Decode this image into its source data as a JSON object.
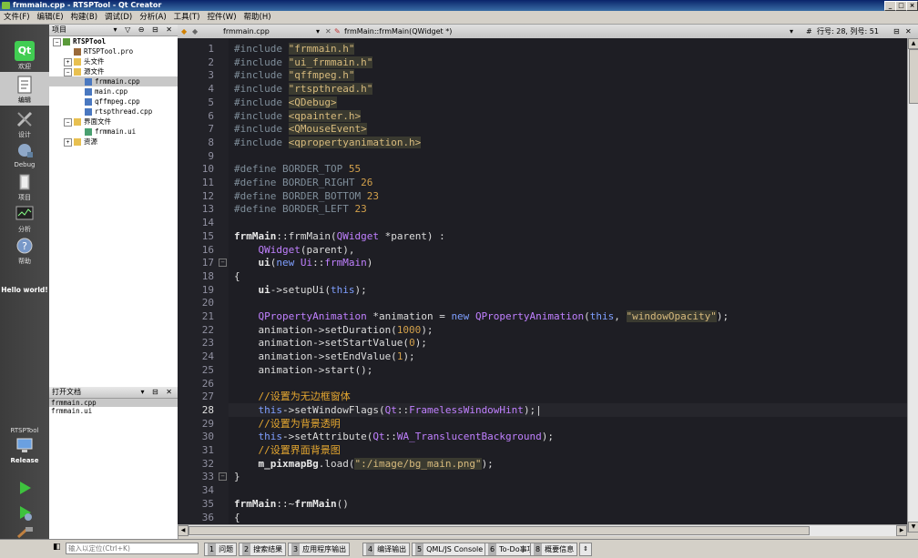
{
  "window": {
    "title": "frmmain.cpp - RTSPTool - Qt Creator",
    "controls": [
      "_",
      "□",
      "×"
    ]
  },
  "menu": [
    "文件(F)",
    "编辑(E)",
    "构建(B)",
    "调试(D)",
    "分析(A)",
    "工具(T)",
    "控件(W)",
    "帮助(H)"
  ],
  "modes": [
    {
      "label": "欢迎",
      "icon": "qt-logo-icon"
    },
    {
      "label": "编辑",
      "icon": "edit-icon"
    },
    {
      "label": "设计",
      "icon": "design-icon"
    },
    {
      "label": "Debug",
      "icon": "debug-icon"
    },
    {
      "label": "项目",
      "icon": "project-icon"
    },
    {
      "label": "分析",
      "icon": "analyze-icon"
    },
    {
      "label": "帮助",
      "icon": "help-icon"
    }
  ],
  "sidebar_note": "Hello world!",
  "kit": {
    "project": "RTSPTool",
    "config": "Release"
  },
  "project_panel": {
    "title": "项目",
    "tree": [
      {
        "label": "RTSPTool",
        "depth": 0,
        "expander": "−",
        "icon": "project"
      },
      {
        "label": "RTSPTool.pro",
        "depth": 1,
        "expander": "",
        "icon": "pro"
      },
      {
        "label": "头文件",
        "depth": 1,
        "expander": "+",
        "icon": "folder"
      },
      {
        "label": "源文件",
        "depth": 1,
        "expander": "−",
        "icon": "folder"
      },
      {
        "label": "frmmain.cpp",
        "depth": 2,
        "expander": "",
        "icon": "cpp",
        "selected": true
      },
      {
        "label": "main.cpp",
        "depth": 2,
        "expander": "",
        "icon": "cpp"
      },
      {
        "label": "qffmpeg.cpp",
        "depth": 2,
        "expander": "",
        "icon": "cpp"
      },
      {
        "label": "rtspthread.cpp",
        "depth": 2,
        "expander": "",
        "icon": "cpp"
      },
      {
        "label": "界面文件",
        "depth": 1,
        "expander": "−",
        "icon": "folder"
      },
      {
        "label": "frmmain.ui",
        "depth": 2,
        "expander": "",
        "icon": "ui"
      },
      {
        "label": "资源",
        "depth": 1,
        "expander": "+",
        "icon": "folder"
      }
    ]
  },
  "open_docs": {
    "title": "打开文档",
    "items": [
      "frmmain.cpp",
      "frmmain.ui"
    ]
  },
  "editor_toolbar": {
    "file": "frmmain.cpp",
    "symbol": "frmMain::frmMain(QWidget *)",
    "position": "行号: 28, 列号: 51"
  },
  "code": {
    "current_line": 28,
    "lines": [
      [
        [
          "pp",
          "#include "
        ],
        [
          "inc",
          "\"frmmain.h\""
        ]
      ],
      [
        [
          "pp",
          "#include "
        ],
        [
          "inc",
          "\"ui_frmmain.h\""
        ]
      ],
      [
        [
          "pp",
          "#include "
        ],
        [
          "inc",
          "\"qffmpeg.h\""
        ]
      ],
      [
        [
          "pp",
          "#include "
        ],
        [
          "inc",
          "\"rtspthread.h\""
        ]
      ],
      [
        [
          "pp",
          "#include "
        ],
        [
          "inc",
          "<QDebug>"
        ]
      ],
      [
        [
          "pp",
          "#include "
        ],
        [
          "inc",
          "<qpainter.h>"
        ]
      ],
      [
        [
          "pp",
          "#include "
        ],
        [
          "inc",
          "<QMouseEvent>"
        ]
      ],
      [
        [
          "pp",
          "#include "
        ],
        [
          "inc",
          "<qpropertyanimation.h>"
        ]
      ],
      [],
      [
        [
          "pp",
          "#define BORDER_TOP "
        ],
        [
          "num",
          "55"
        ]
      ],
      [
        [
          "pp",
          "#define BORDER_RIGHT "
        ],
        [
          "num",
          "26"
        ]
      ],
      [
        [
          "pp",
          "#define BORDER_BOTTOM "
        ],
        [
          "num",
          "23"
        ]
      ],
      [
        [
          "pp",
          "#define BORDER_LEFT "
        ],
        [
          "num",
          "23"
        ]
      ],
      [],
      [
        [
          "cls",
          "frmMain"
        ],
        [
          "txt",
          "::frmMain("
        ],
        [
          "typ",
          "QWidget"
        ],
        [
          "txt",
          " *parent) :"
        ]
      ],
      [
        [
          "txt",
          "    "
        ],
        [
          "typ",
          "QWidget"
        ],
        [
          "txt",
          "(parent),"
        ]
      ],
      [
        [
          "txt",
          "    "
        ],
        [
          "cls",
          "ui"
        ],
        [
          "txt",
          "("
        ],
        [
          "kw",
          "new"
        ],
        [
          "txt",
          " "
        ],
        [
          "typ",
          "Ui"
        ],
        [
          "txt",
          "::"
        ],
        [
          "typ",
          "frmMain"
        ],
        [
          "txt",
          ")"
        ]
      ],
      [
        [
          "txt",
          "{"
        ]
      ],
      [
        [
          "txt",
          "    "
        ],
        [
          "cls",
          "ui"
        ],
        [
          "txt",
          "->setupUi("
        ],
        [
          "kw",
          "this"
        ],
        [
          "txt",
          ");"
        ]
      ],
      [],
      [
        [
          "txt",
          "    "
        ],
        [
          "typ",
          "QPropertyAnimation"
        ],
        [
          "txt",
          " *animation = "
        ],
        [
          "kw",
          "new"
        ],
        [
          "txt",
          " "
        ],
        [
          "typ",
          "QPropertyAnimation"
        ],
        [
          "txt",
          "("
        ],
        [
          "kw",
          "this"
        ],
        [
          "txt",
          ", "
        ],
        [
          "str",
          "\"windowOpacity\""
        ],
        [
          "txt",
          ");"
        ]
      ],
      [
        [
          "txt",
          "    animation->setDuration("
        ],
        [
          "num",
          "1000"
        ],
        [
          "txt",
          ");"
        ]
      ],
      [
        [
          "txt",
          "    animation->setStartValue("
        ],
        [
          "num",
          "0"
        ],
        [
          "txt",
          ");"
        ]
      ],
      [
        [
          "txt",
          "    animation->setEndValue("
        ],
        [
          "num",
          "1"
        ],
        [
          "txt",
          ");"
        ]
      ],
      [
        [
          "txt",
          "    animation->start();"
        ]
      ],
      [],
      [
        [
          "cm",
          "    //设置为无边框窗体"
        ]
      ],
      [
        [
          "txt",
          "    "
        ],
        [
          "kw",
          "this"
        ],
        [
          "txt",
          "->setWindowFlags("
        ],
        [
          "typ",
          "Qt"
        ],
        [
          "txt",
          "::"
        ],
        [
          "typ",
          "FramelessWindowHint"
        ],
        [
          "txt",
          ");|"
        ]
      ],
      [
        [
          "cm",
          "    //设置为背景透明"
        ]
      ],
      [
        [
          "txt",
          "    "
        ],
        [
          "kw",
          "this"
        ],
        [
          "txt",
          "->setAttribute("
        ],
        [
          "typ",
          "Qt"
        ],
        [
          "txt",
          "::"
        ],
        [
          "typ",
          "WA_TranslucentBackground"
        ],
        [
          "txt",
          ");"
        ]
      ],
      [
        [
          "cm",
          "    //设置界面背景图"
        ]
      ],
      [
        [
          "txt",
          "    "
        ],
        [
          "cls",
          "m_pixmapBg"
        ],
        [
          "txt",
          ".load("
        ],
        [
          "str",
          "\":/image/bg_main.png\""
        ],
        [
          "txt",
          ");"
        ]
      ],
      [
        [
          "txt",
          "}"
        ]
      ],
      [],
      [
        [
          "cls",
          "frmMain"
        ],
        [
          "txt",
          "::~"
        ],
        [
          "cls",
          "frmMain"
        ],
        [
          "txt",
          "()"
        ]
      ],
      [
        [
          "txt",
          "{"
        ]
      ]
    ]
  },
  "folds": [
    17,
    33
  ],
  "locator_placeholder": "输入以定位(Ctrl+K)",
  "status_tabs": [
    "1 问题",
    "2 搜索结果",
    "3 应用程序输出",
    "4 编译输出",
    "5 QML/JS Console",
    "6 To-Do事项",
    "8 概要信息"
  ],
  "colors": {
    "editor_bg": "#1e1e24",
    "mode_bar": "#3c3c3c",
    "title_bar": "#0a246a"
  }
}
